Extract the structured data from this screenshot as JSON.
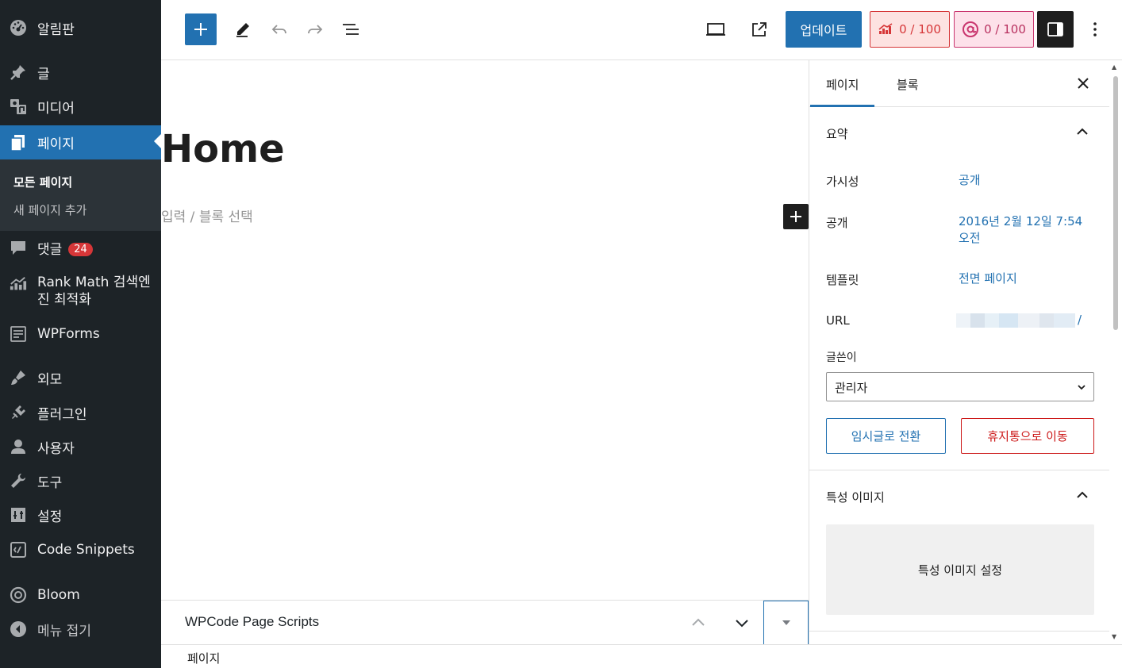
{
  "sidebar": {
    "items": [
      {
        "label": "알림판",
        "icon": "dashboard-icon"
      },
      {
        "label": "글",
        "icon": "pin-icon"
      },
      {
        "label": "미디어",
        "icon": "media-icon"
      },
      {
        "label": "페이지",
        "icon": "pages-icon"
      },
      {
        "label": "댓글",
        "icon": "comment-icon",
        "badge": "24"
      },
      {
        "label": "Rank Math 검색엔진 최적화",
        "icon": "rankmath-icon"
      },
      {
        "label": "WPForms",
        "icon": "wpforms-icon"
      },
      {
        "label": "외모",
        "icon": "brush-icon"
      },
      {
        "label": "플러그인",
        "icon": "plugin-icon"
      },
      {
        "label": "사용자",
        "icon": "user-icon"
      },
      {
        "label": "도구",
        "icon": "wrench-icon"
      },
      {
        "label": "설정",
        "icon": "settings-icon"
      },
      {
        "label": "Code Snippets",
        "icon": "code-icon"
      },
      {
        "label": "Bloom",
        "icon": "bloom-icon"
      },
      {
        "label": "메뉴 접기",
        "icon": "collapse-icon"
      }
    ],
    "submenu": {
      "all_pages": "모든 페이지",
      "add_new": "새 페이지 추가"
    }
  },
  "toolbar": {
    "update_label": "업데이트",
    "rankmath_score": "0 / 100",
    "ai_score": "0 / 100"
  },
  "editor": {
    "title": "Home",
    "placeholder": "입력 / 블록 선택"
  },
  "metabox": {
    "title": "WPCode Page Scripts"
  },
  "breadcrumb": {
    "label": "페이지"
  },
  "settings": {
    "tabs": {
      "page": "페이지",
      "block": "블록"
    },
    "summary": {
      "heading": "요약",
      "visibility_label": "가시성",
      "visibility_value": "공개",
      "publish_label": "공개",
      "publish_value": "2016년 2월 12일 7:54 오전",
      "template_label": "템플릿",
      "template_value": "전면 페이지",
      "url_label": "URL",
      "url_suffix": "/",
      "author_label": "글쓴이",
      "author_value": "관리자",
      "draft_button": "임시글로 전환",
      "trash_button": "휴지통으로 이동"
    },
    "featured": {
      "heading": "특성 이미지",
      "set_button": "특성 이미지 설정"
    }
  },
  "colors": {
    "accent": "#2271b1",
    "sidebar_bg": "#1d2327",
    "danger": "#cc1818",
    "badge": "#d63638"
  }
}
